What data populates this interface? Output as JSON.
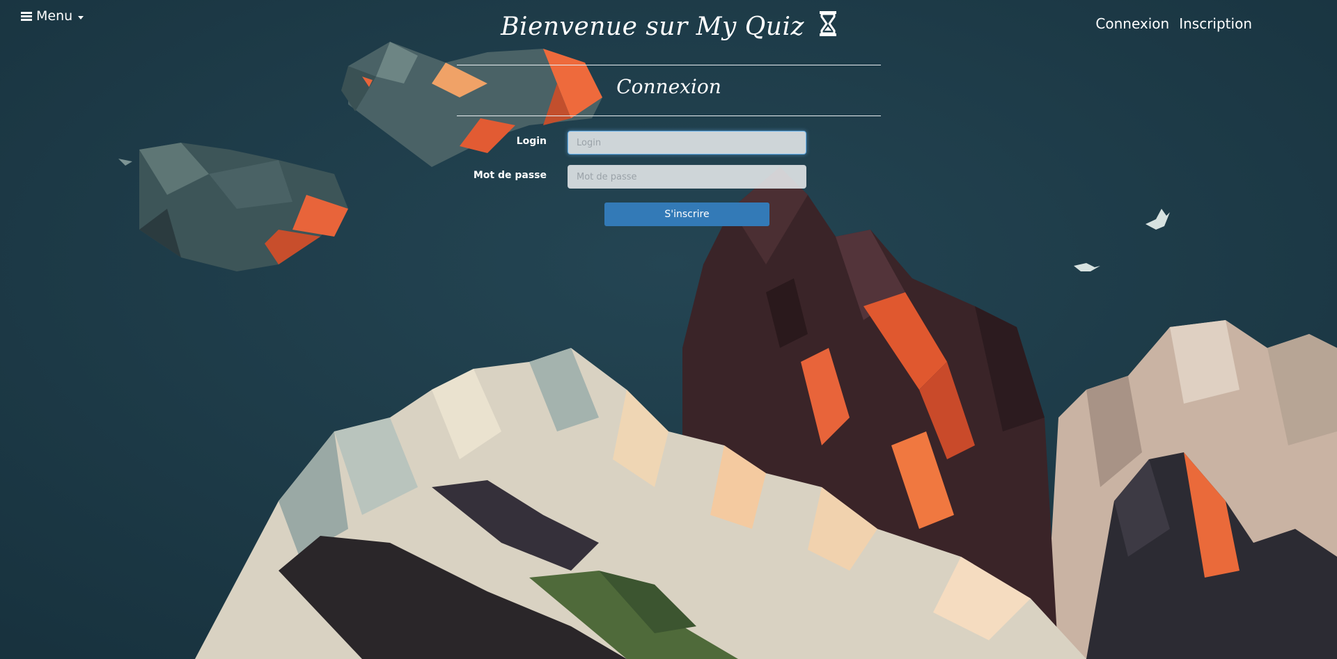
{
  "nav": {
    "menu_label": "Menu",
    "links": [
      "Connexion",
      "Inscription"
    ]
  },
  "header": {
    "title": "Bienvenue sur My Quiz",
    "title_icon": "hourglass-icon"
  },
  "form": {
    "heading": "Connexion",
    "login_label": "Login",
    "login_placeholder": "Login",
    "login_value": "",
    "password_label": "Mot de passe",
    "password_placeholder": "Mot de passe",
    "password_value": "",
    "submit_label": "S'inscrire"
  },
  "colors": {
    "background": "#1d3a48",
    "button": "#337ab7",
    "text": "#ffffff",
    "accent_orange": "#e8643a"
  }
}
